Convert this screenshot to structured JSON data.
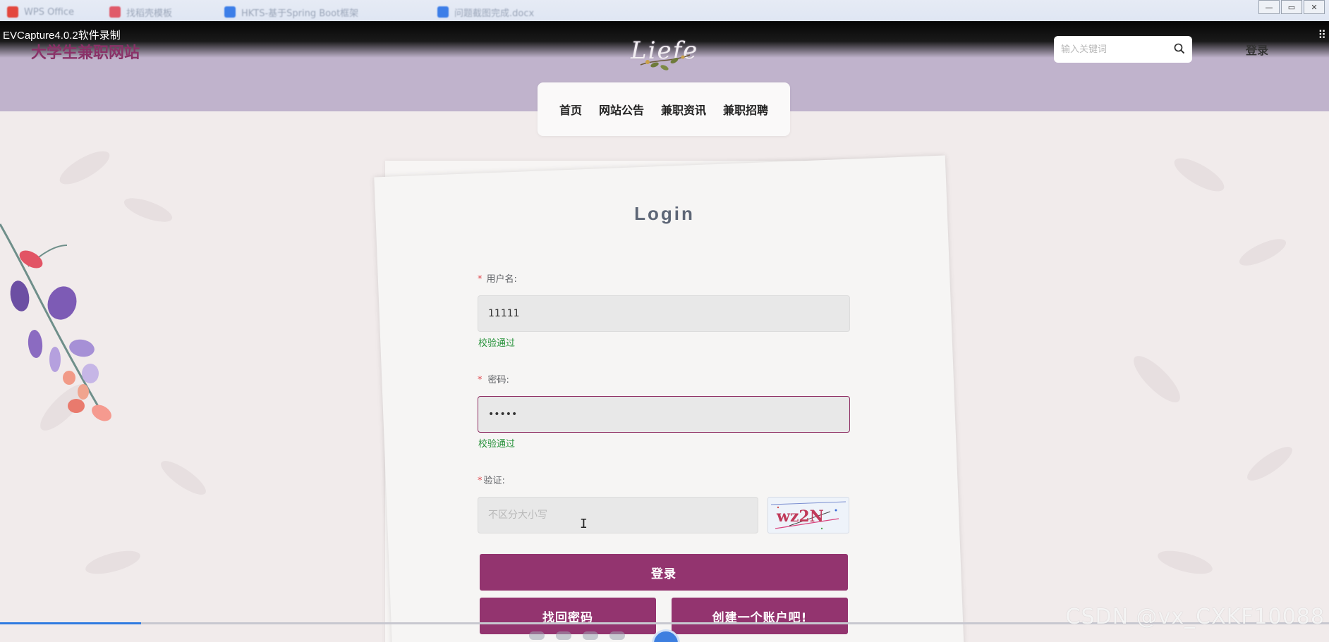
{
  "os_taskbar": {
    "tabs": [
      "WPS Office",
      "找稻壳模板",
      "HKTS-基于Spring Boot框架",
      "问题截图完成.docx"
    ]
  },
  "recording": {
    "title": "EVCapture4.0.2软件录制"
  },
  "header": {
    "site_title": "大学生兼职网站",
    "logo_text": "Liefe",
    "search_placeholder": "输入关键词",
    "login_label": "登录"
  },
  "nav": {
    "items": [
      {
        "label": "首页"
      },
      {
        "label": "网站公告"
      },
      {
        "label": "兼职资讯"
      },
      {
        "label": "兼职招聘"
      }
    ]
  },
  "form": {
    "heading": "Login",
    "username": {
      "label": "用户名:",
      "value": "11111",
      "status": "校验通过"
    },
    "password": {
      "label": "密码:",
      "value": "•••••",
      "status": "校验通过"
    },
    "captcha": {
      "label": "验证:",
      "placeholder": "不区分大小写",
      "image_text": "wz2N"
    },
    "login_button": "登录",
    "forgot_button": "找回密码",
    "register_button": "创建一个账户吧!"
  },
  "player": {
    "progress": 0.106
  },
  "watermark": "CSDN @vx_CXKF10088",
  "colors": {
    "header_bg": "#c0b3cc",
    "brand": "#93346f",
    "valid": "#27923a",
    "required": "#e0494f"
  }
}
